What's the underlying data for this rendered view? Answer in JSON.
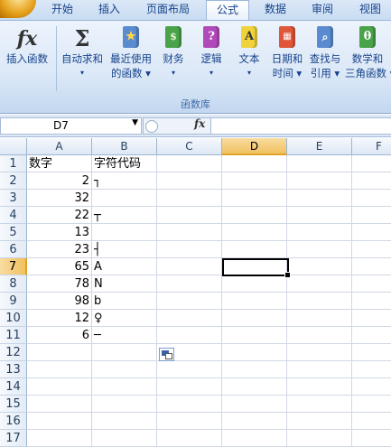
{
  "ribbon_tabs": [
    "开始",
    "插入",
    "页面布局",
    "公式",
    "数据",
    "审阅",
    "视图"
  ],
  "active_tab": "公式",
  "ribbon_buttons": {
    "insert_function": {
      "line1": "插入函数",
      "line2": "",
      "icon": "fx-icon"
    },
    "autosum": {
      "line1": "自动求和",
      "line2": "▾",
      "icon": "sigma-icon"
    },
    "recent": {
      "line1": "最近使用",
      "line2": "的函数 ▾",
      "icon": "star-book-icon"
    },
    "financial": {
      "line1": "财务",
      "line2": "▾",
      "icon": "finance-book-icon"
    },
    "logical": {
      "line1": "逻辑",
      "line2": "▾",
      "icon": "question-book-icon"
    },
    "text": {
      "line1": "文本",
      "line2": "▾",
      "icon": "text-book-icon"
    },
    "datetime": {
      "line1": "日期和",
      "line2": "时间 ▾",
      "icon": "calendar-book-icon"
    },
    "lookup": {
      "line1": "查找与",
      "line2": "引用 ▾",
      "icon": "lookup-book-icon"
    },
    "math": {
      "line1": "数学和",
      "line2": "三角函数 ▾",
      "icon": "theta-book-icon"
    }
  },
  "ribbon_group_label": "函数库",
  "formula_bar": {
    "name_box": "D7",
    "fx_label": "fx",
    "formula": ""
  },
  "columns": [
    "A",
    "B",
    "C",
    "D",
    "E",
    "F"
  ],
  "selected_column": "D",
  "selected_row": "7",
  "rows": [
    {
      "n": "1",
      "a": "数字",
      "b": "字符代码"
    },
    {
      "n": "2",
      "a": "2",
      "b": "┐"
    },
    {
      "n": "3",
      "a": "32",
      "b": ""
    },
    {
      "n": "4",
      "a": "22",
      "b": "┬"
    },
    {
      "n": "5",
      "a": "13",
      "b": ""
    },
    {
      "n": "6",
      "a": "23",
      "b": "┤"
    },
    {
      "n": "7",
      "a": "65",
      "b": "A"
    },
    {
      "n": "8",
      "a": "78",
      "b": "N"
    },
    {
      "n": "9",
      "a": "98",
      "b": "b"
    },
    {
      "n": "10",
      "a": "12",
      "b": "♀"
    },
    {
      "n": "11",
      "a": "6",
      "b": "─"
    },
    {
      "n": "12",
      "a": "",
      "b": ""
    },
    {
      "n": "13",
      "a": "",
      "b": ""
    },
    {
      "n": "14",
      "a": "",
      "b": ""
    },
    {
      "n": "15",
      "a": "",
      "b": ""
    },
    {
      "n": "16",
      "a": "",
      "b": ""
    },
    {
      "n": "17",
      "a": "",
      "b": ""
    }
  ],
  "colors": {
    "accent": "#15428b",
    "selection_header": "#f1c15f"
  }
}
